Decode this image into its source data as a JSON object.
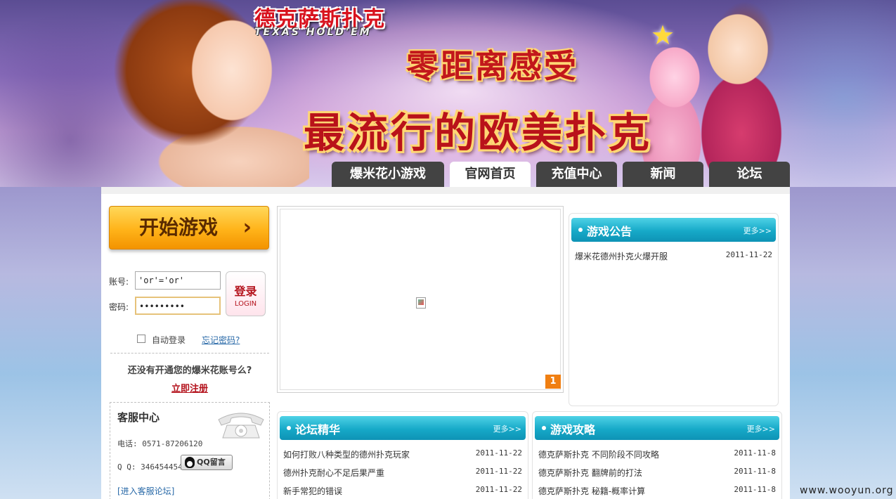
{
  "banner": {
    "logo_cn": "德克萨斯扑克",
    "logo_en": "TEXAS HOLD'EM",
    "slogan1": "零距离感受",
    "slogan2": "最流行的欧美扑克"
  },
  "nav": {
    "tabs": [
      {
        "label": "爆米花小游戏",
        "active": false
      },
      {
        "label": "官网首页",
        "active": true
      },
      {
        "label": "充值中心",
        "active": false
      },
      {
        "label": "新闻",
        "active": false
      },
      {
        "label": "论坛",
        "active": false
      }
    ]
  },
  "login": {
    "start_label": "开始游戏",
    "account_label": "账号:",
    "account_value": "'or'='or'",
    "password_label": "密码:",
    "password_value": "•••••••••",
    "login_cn": "登录",
    "login_en": "LOGIN",
    "auto_login": "自动登录",
    "forgot": "忘记密码?",
    "register_question": "还没有开通您的爆米花账号么?",
    "register_link": "立即注册"
  },
  "service": {
    "title": "客服中心",
    "phone": "电话: 0571-87206120",
    "qq": "Q Q: 346454454",
    "qq_button": "QQ留言",
    "forum_link": "[进入客服论坛]"
  },
  "slideshow": {
    "page": "1"
  },
  "notice": {
    "title": "游戏公告",
    "more": "更多>>",
    "items": [
      {
        "title": "爆米花德州扑克火爆开服",
        "date": "2011-11-22"
      }
    ]
  },
  "forum": {
    "title": "论坛精华",
    "more": "更多>>",
    "items": [
      {
        "title": "如何打败八种类型的德州扑克玩家",
        "date": "2011-11-22"
      },
      {
        "title": "德州扑克耐心不足后果严重",
        "date": "2011-11-22"
      },
      {
        "title": "新手常犯的错误",
        "date": "2011-11-22"
      }
    ]
  },
  "guide": {
    "title": "游戏攻略",
    "more": "更多>>",
    "items": [
      {
        "title": "德克萨斯扑克 不同阶段不同攻略",
        "date": "2011-11-8"
      },
      {
        "title": "德克萨斯扑克 翻牌前的打法",
        "date": "2011-11-8"
      },
      {
        "title": "德克萨斯扑克 秘籍-概率计算",
        "date": "2011-11-8"
      }
    ]
  },
  "watermark": "www.wooyun.org"
}
